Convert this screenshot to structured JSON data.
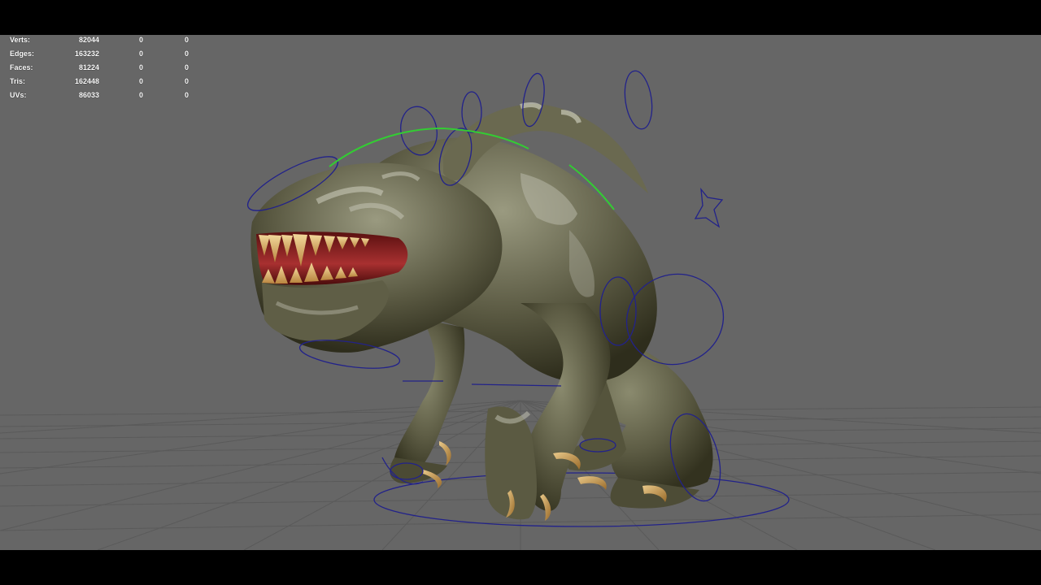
{
  "hud": {
    "rows": [
      {
        "label": "Verts:",
        "total": "82044",
        "selected": "0",
        "selected_component": "0"
      },
      {
        "label": "Edges:",
        "total": "163232",
        "selected": "0",
        "selected_component": "0"
      },
      {
        "label": "Faces:",
        "total": "81224",
        "selected": "0",
        "selected_component": "0"
      },
      {
        "label": "Tris:",
        "total": "162448",
        "selected": "0",
        "selected_component": "0"
      },
      {
        "label": "UVs:",
        "total": "86033",
        "selected": "0",
        "selected_component": "0"
      }
    ]
  },
  "viewport": {
    "background_color": "#666666",
    "grid_color": "#5a5a5a",
    "rig_control_color": "#22228a",
    "rig_highlight_color": "#33cc33",
    "model": "creature-model"
  }
}
